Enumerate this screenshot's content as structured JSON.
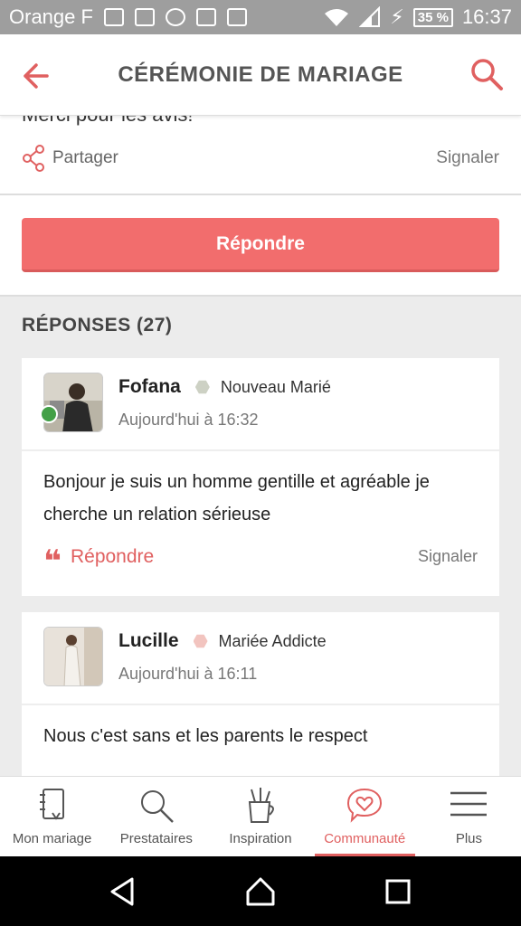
{
  "status_bar": {
    "carrier": "Orange F",
    "battery": "35 %",
    "time": "16:37"
  },
  "app_bar": {
    "title": "CÉRÉMONIE DE MARIAGE"
  },
  "post": {
    "cut_text": "Merci pour les avis!",
    "share_label": "Partager",
    "report_label": "Signaler"
  },
  "reply_button": {
    "label": "Répondre"
  },
  "responses": {
    "title": "RÉPONSES (27)",
    "items": [
      {
        "name": "Fofana",
        "rank": "Nouveau Marié",
        "rank_color": "#cdd1c4",
        "time": "Aujourd'hui à 16:32",
        "text": "Bonjour je suis un homme gentille et agréable je cherche un relation sérieuse",
        "reply_label": "Répondre",
        "report_label": "Signaler",
        "online": true
      },
      {
        "name": "Lucille",
        "rank": "Mariée Addicte",
        "rank_color": "#f2c4bf",
        "time": "Aujourd'hui à 16:11",
        "text": "Nous c'est sans et les parents le respect"
      }
    ]
  },
  "bottom_nav": {
    "items": [
      {
        "label": "Mon mariage",
        "icon": "notebook-icon"
      },
      {
        "label": "Prestataires",
        "icon": "search-icon"
      },
      {
        "label": "Inspiration",
        "icon": "cup-pencils-icon"
      },
      {
        "label": "Communauté",
        "icon": "heart-chat-icon",
        "active": true
      },
      {
        "label": "Plus",
        "icon": "menu-icon"
      }
    ]
  },
  "colors": {
    "accent": "#f26d6d",
    "link": "#e06060"
  }
}
